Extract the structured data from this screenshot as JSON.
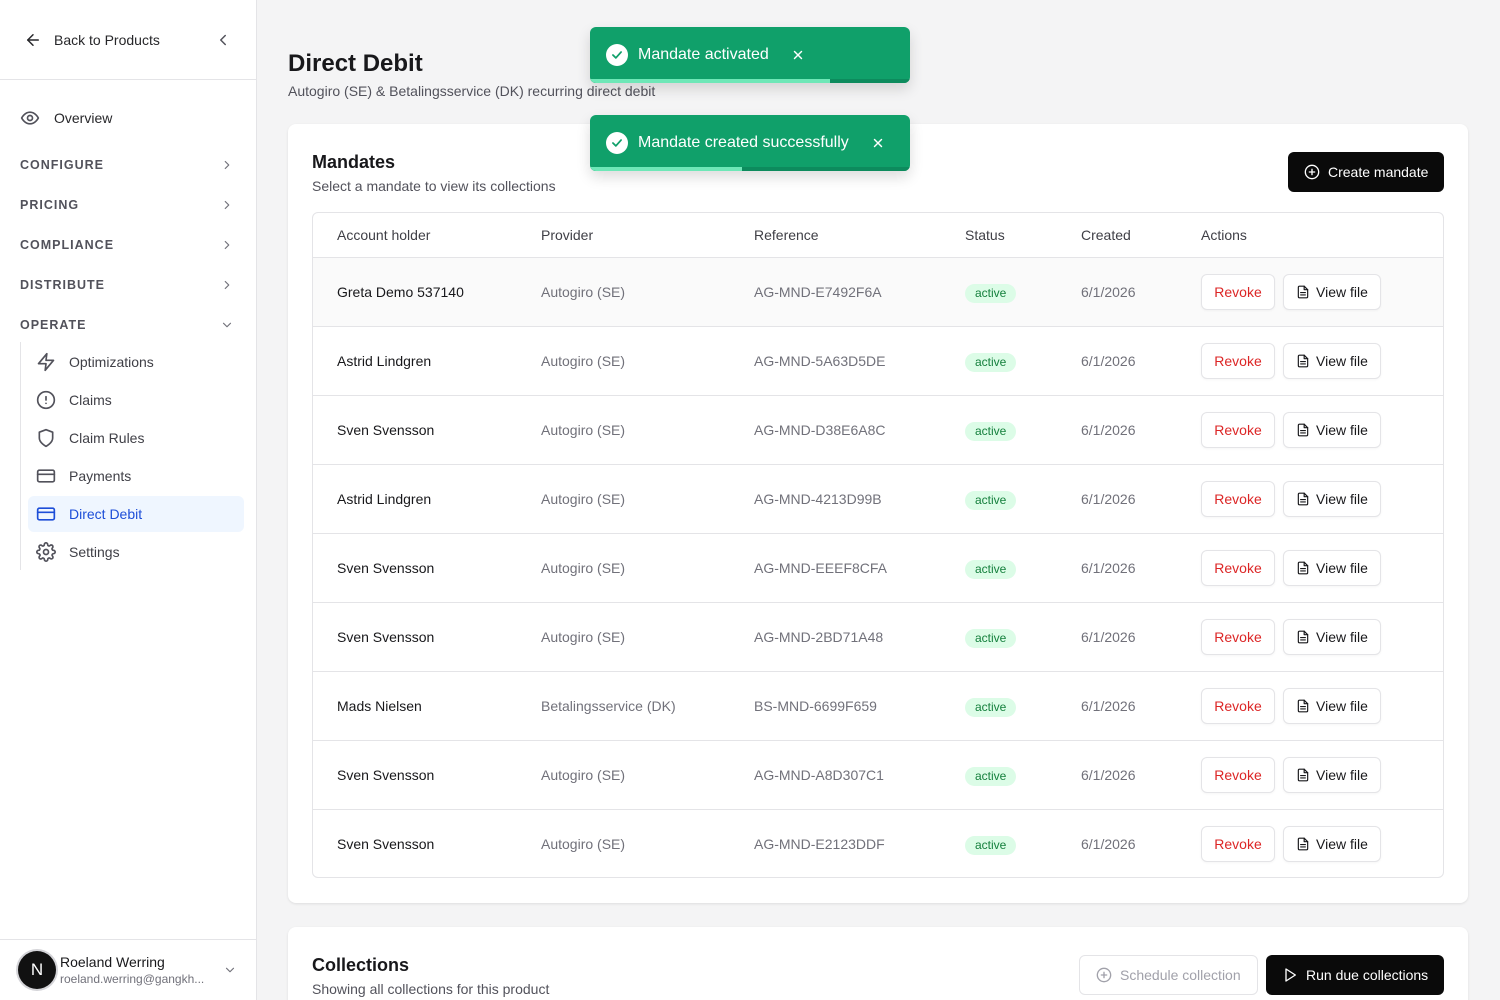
{
  "sidebar": {
    "back_label": "Back to Products",
    "overview_label": "Overview",
    "sections": [
      "CONFIGURE",
      "PRICING",
      "COMPLIANCE",
      "DISTRIBUTE",
      "OPERATE"
    ],
    "operate_items": [
      {
        "label": "Optimizations",
        "icon": "lightning-icon"
      },
      {
        "label": "Claims",
        "icon": "alert-circle-icon"
      },
      {
        "label": "Claim Rules",
        "icon": "shield-icon"
      },
      {
        "label": "Payments",
        "icon": "credit-card-icon"
      },
      {
        "label": "Direct Debit",
        "icon": "credit-card-icon",
        "active": true
      },
      {
        "label": "Settings",
        "icon": "gear-icon"
      }
    ],
    "user": {
      "initial": "N",
      "name": "Roeland Werring",
      "email": "roeland.werring@gangkh..."
    }
  },
  "page": {
    "title": "Direct Debit",
    "subtitle": "Autogiro (SE) & Betalingsservice (DK) recurring direct debit"
  },
  "mandates": {
    "title": "Mandates",
    "subtitle": "Select a mandate to view its collections",
    "create_label": "Create mandate",
    "columns": [
      "Account holder",
      "Provider",
      "Reference",
      "Status",
      "Created",
      "Actions"
    ],
    "revoke_label": "Revoke",
    "view_label": "View file",
    "rows": [
      {
        "name": "Greta Demo 537140",
        "provider": "Autogiro (SE)",
        "reference": "AG-MND-E7492F6A",
        "status": "active",
        "created": "6/1/2026"
      },
      {
        "name": "Astrid Lindgren",
        "provider": "Autogiro (SE)",
        "reference": "AG-MND-5A63D5DE",
        "status": "active",
        "created": "6/1/2026"
      },
      {
        "name": "Sven Svensson",
        "provider": "Autogiro (SE)",
        "reference": "AG-MND-D38E6A8C",
        "status": "active",
        "created": "6/1/2026"
      },
      {
        "name": "Astrid Lindgren",
        "provider": "Autogiro (SE)",
        "reference": "AG-MND-4213D99B",
        "status": "active",
        "created": "6/1/2026"
      },
      {
        "name": "Sven Svensson",
        "provider": "Autogiro (SE)",
        "reference": "AG-MND-EEEF8CFA",
        "status": "active",
        "created": "6/1/2026"
      },
      {
        "name": "Sven Svensson",
        "provider": "Autogiro (SE)",
        "reference": "AG-MND-2BD71A48",
        "status": "active",
        "created": "6/1/2026"
      },
      {
        "name": "Mads Nielsen",
        "provider": "Betalingsservice (DK)",
        "reference": "BS-MND-6699F659",
        "status": "active",
        "created": "6/1/2026"
      },
      {
        "name": "Sven Svensson",
        "provider": "Autogiro (SE)",
        "reference": "AG-MND-A8D307C1",
        "status": "active",
        "created": "6/1/2026"
      },
      {
        "name": "Sven Svensson",
        "provider": "Autogiro (SE)",
        "reference": "AG-MND-E2123DDF",
        "status": "active",
        "created": "6/1/2026"
      }
    ]
  },
  "collections": {
    "title": "Collections",
    "subtitle": "Showing all collections for this product",
    "schedule_label": "Schedule collection",
    "run_label": "Run due collections"
  },
  "toasts": [
    {
      "message": "Mandate activated",
      "progress": 0.75
    },
    {
      "message": "Mandate created successfully",
      "progress": 0.475
    }
  ],
  "colors": {
    "toast_bg": "#10a06a",
    "active_nav": "#1d4ed8",
    "revoke": "#dc2626",
    "badge_bg": "#dcfce7",
    "badge_text": "#15803d"
  }
}
